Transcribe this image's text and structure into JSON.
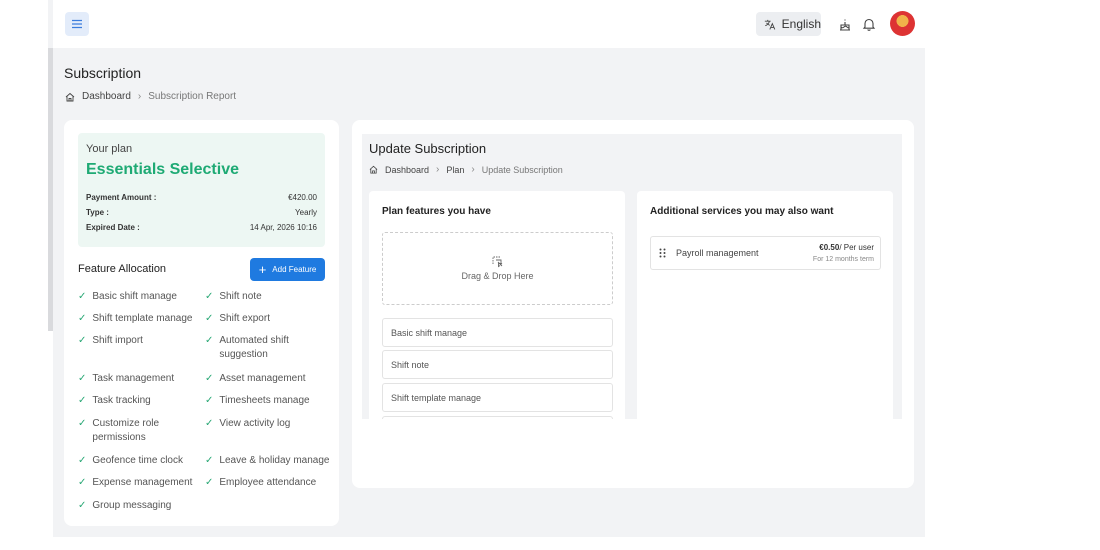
{
  "header": {
    "language": "English"
  },
  "page": {
    "title": "Subscription",
    "breadcrumb": [
      "Dashboard",
      "Subscription Report"
    ]
  },
  "plan": {
    "label": "Your plan",
    "name": "Essentials Selective",
    "fields": [
      {
        "key": "Payment Amount :",
        "value": "€420.00"
      },
      {
        "key": "Type :",
        "value": "Yearly"
      },
      {
        "key": "Expired Date :",
        "value": "14 Apr, 2026 10:16"
      }
    ]
  },
  "feature_allocation": {
    "title": "Feature Allocation",
    "add_button": "Add Feature",
    "features": [
      "Basic shift manage",
      "Shift note",
      "Shift template manage",
      "Shift export",
      "Shift import",
      "Automated shift suggestion",
      "Task management",
      "Asset management",
      "Task tracking",
      "Timesheets manage",
      "Customize role permissions",
      "View activity log",
      "Geofence time clock",
      "Leave & holiday manage",
      "Expense management",
      "Employee attendance",
      "Group messaging"
    ]
  },
  "update": {
    "title": "Update Subscription",
    "breadcrumb": [
      "Dashboard",
      "Plan",
      "Update Subscription"
    ],
    "plan_features": {
      "title": "Plan features you have",
      "dropzone": "Drag & Drop Here",
      "items": [
        "Basic shift manage",
        "Shift note",
        "Shift template manage"
      ]
    },
    "additional": {
      "title": "Additional services you may also want",
      "services": [
        {
          "name": "Payroll management",
          "price": "€0.50",
          "unit": "/ Per user",
          "term": "For 12 months term"
        }
      ]
    }
  },
  "colors": {
    "accent": "#1f7ae0",
    "plan_name": "#1eaa74",
    "check": "#2aa876"
  }
}
